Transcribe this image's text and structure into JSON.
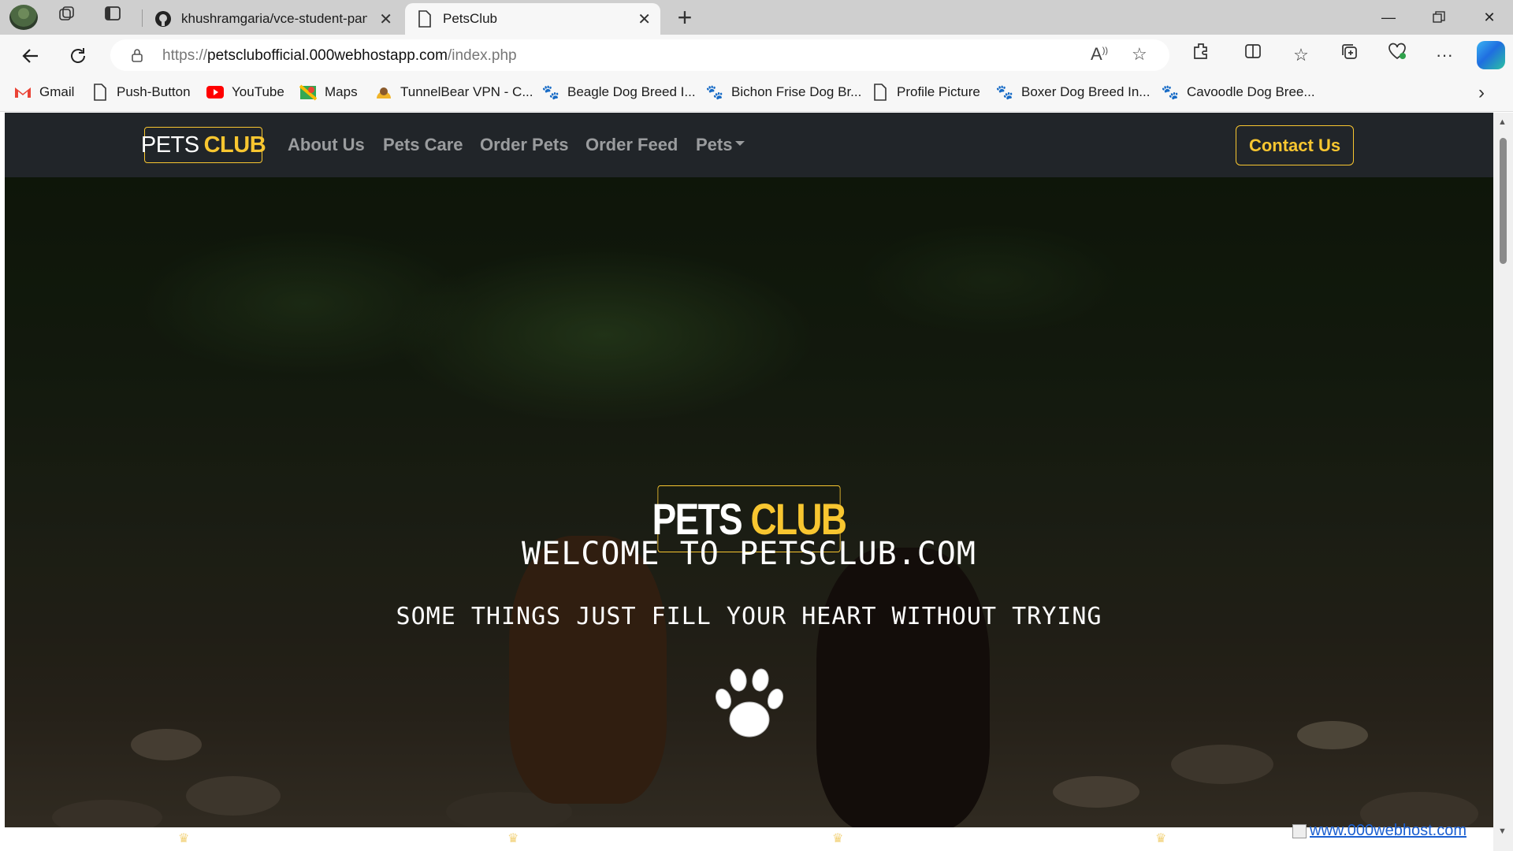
{
  "browser": {
    "tabs": [
      {
        "title": "khushramgaria/vce-student-panel",
        "icon": "github-icon",
        "active": false
      },
      {
        "title": "PetsClub",
        "icon": "page-icon",
        "active": true
      }
    ],
    "url": {
      "prefix": "https://",
      "host": "petsclubofficial.000webhostapp.com",
      "path": "/index.php"
    },
    "bookmarks": [
      {
        "label": "Gmail",
        "icon": "gmail-icon"
      },
      {
        "label": "Push-Button",
        "icon": "page-icon"
      },
      {
        "label": "YouTube",
        "icon": "youtube-icon"
      },
      {
        "label": "Maps",
        "icon": "maps-icon"
      },
      {
        "label": "TunnelBear VPN - C...",
        "icon": "tunnelbear-icon"
      },
      {
        "label": "Beagle Dog Breed I...",
        "icon": "paw-icon"
      },
      {
        "label": "Bichon Frise Dog Br...",
        "icon": "paw-icon"
      },
      {
        "label": "Profile Picture",
        "icon": "page-icon"
      },
      {
        "label": "Boxer Dog Breed In...",
        "icon": "paw-icon"
      },
      {
        "label": "Cavoodle Dog Bree...",
        "icon": "paw-icon"
      }
    ]
  },
  "site": {
    "brand": {
      "part1": "PETS",
      "part2": "CLUB"
    },
    "nav": [
      "About Us",
      "Pets Care",
      "Order Pets",
      "Order Feed",
      "Pets"
    ],
    "contact_label": "Contact Us",
    "hero": {
      "logo_part1": "PETS",
      "logo_part2": "CLUB",
      "title": "WELCOME TO PETSCLUB.COM",
      "subtitle": "SOME THINGS JUST FILL YOUR HEART WITHOUT TRYING"
    },
    "host_link": "www.000webhost.com"
  },
  "colors": {
    "accent": "#f8c630",
    "navbar": "#212529",
    "link": "#1a5fd1"
  }
}
